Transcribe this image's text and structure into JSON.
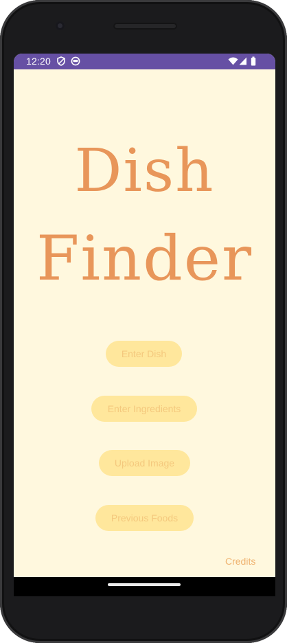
{
  "status_bar": {
    "time": "12:20",
    "left_icons": [
      "shield-icon",
      "face-icon"
    ],
    "right_icons": [
      "wifi-icon",
      "signal-icon",
      "battery-icon"
    ],
    "color": "#6650a4"
  },
  "app": {
    "title_line1": "Dish",
    "title_line2": "Finder",
    "accent_color": "#e8965a",
    "background_color": "#fff8de",
    "button_color": "#ffe79c"
  },
  "buttons": {
    "enter_dish": "Enter Dish",
    "enter_ingredients": "Enter Ingredients",
    "upload_image": "Upload Image",
    "previous_foods": "Previous Foods"
  },
  "credits_label": "Credits"
}
